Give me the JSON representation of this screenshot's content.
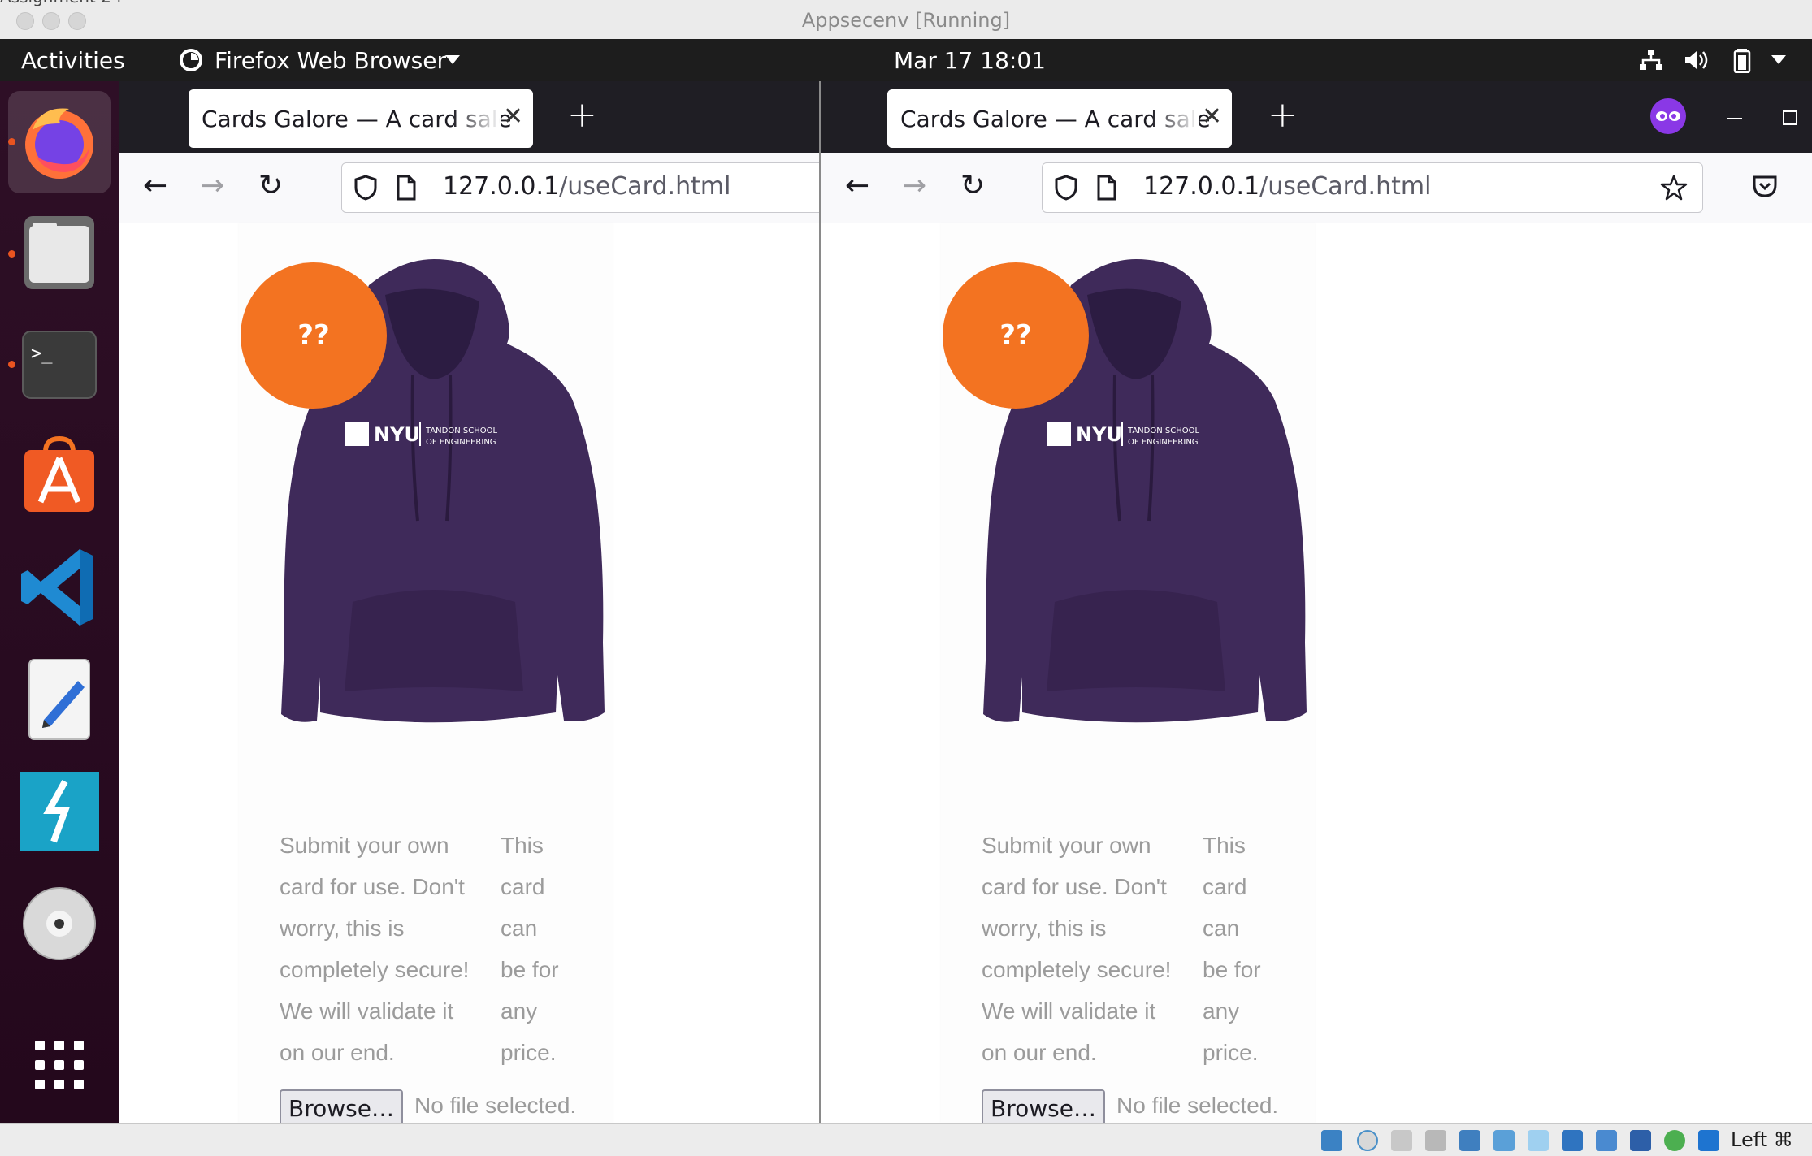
{
  "mac_window": {
    "title": "Appsecenv [Running]",
    "stray_text": "Assignment 2 f"
  },
  "top_panel": {
    "activities": "Activities",
    "app_name": "Firefox Web Browser",
    "datetime": "Mar 17  18:01"
  },
  "dock": {
    "items": [
      "firefox-icon",
      "files-icon",
      "terminal-icon",
      "app-store-icon",
      "vscode-icon",
      "text-editor-icon",
      "zap-icon",
      "disc-icon",
      "app-grid-icon"
    ]
  },
  "browser_left": {
    "tab_title": "Cards Galore — A card sale s",
    "url_host": "127.0.0.1",
    "url_path": "/useCard.html"
  },
  "browser_right": {
    "tab_title": "Cards Galore — A card sale s",
    "url_host": "127.0.0.1",
    "url_path": "/useCard.html"
  },
  "page": {
    "badge_text": "??",
    "product_logo": "NYU | TANDON SCHOOL OF ENGINEERING",
    "description_col1": [
      "Submit your own",
      "card for use. Don't",
      "worry, this is",
      "completely secure!",
      "We will validate it",
      "on our end."
    ],
    "description_col2": [
      "This",
      "card",
      "can",
      "be for",
      "any",
      "price."
    ],
    "browse_label": "Browse…",
    "no_file": "No file selected."
  },
  "status_bar": {
    "host_key": "Left ⌘"
  },
  "colors": {
    "badge": "#f37321",
    "hoodie": "#3f2a5a",
    "dock_bg": "#2e0f26",
    "panel_bg": "#1d1d1d",
    "tabbar_bg": "#1f1e24"
  }
}
